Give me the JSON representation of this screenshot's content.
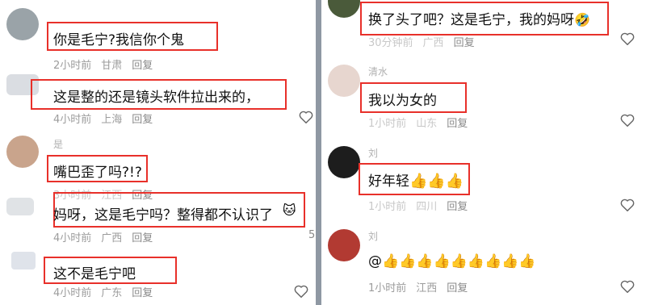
{
  "left": {
    "comments": [
      {
        "username": "",
        "text": "你是毛宁?我信你个鬼",
        "time": "2小时前",
        "location": "甘肃",
        "reply": "回复"
      },
      {
        "username": "",
        "text": "这是整的还是镜头软件拉出来的，",
        "time": "4小时前",
        "location": "上海",
        "reply": "回复"
      },
      {
        "username": "是",
        "text": "嘴巴歪了吗?!?",
        "time": "3小时前",
        "location": "江西",
        "reply": "回复"
      },
      {
        "username": "",
        "text": "妈呀，这是毛宁吗？整得都不认识了",
        "time": "4小时前",
        "location": "广西",
        "reply": "回复",
        "likes": "5"
      },
      {
        "username": "",
        "text": "这不是毛宁吧",
        "time": "4小时前",
        "location": "广东",
        "reply": "回复"
      }
    ]
  },
  "right": {
    "comments": [
      {
        "username": "",
        "text": "换了头了吧？这是毛宁，我的妈呀",
        "time": "30分钟前",
        "location": "广西",
        "reply": "回复"
      },
      {
        "username": "清水",
        "text": "我以为女的",
        "time": "1小时前",
        "location": "山东",
        "reply": "回复"
      },
      {
        "username": "刘",
        "text": "好年轻",
        "time": "1小时前",
        "location": "四川",
        "reply": "回复"
      },
      {
        "username": "刘",
        "text": "@",
        "time": "1小时前",
        "location": "江西",
        "reply": "回复"
      }
    ]
  },
  "icons": {
    "heart": "heart-outline-icon",
    "thumbs": "thumbs-up-emoji",
    "laugh": "laughing-emoji",
    "cat": "cat-face-emoji"
  },
  "colors": {
    "highlight": "#e8302a",
    "meta": "#9c9c9c",
    "divider": "#8f98a3"
  }
}
